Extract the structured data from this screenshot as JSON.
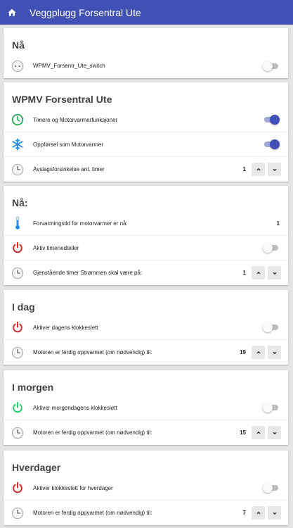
{
  "app": {
    "title": "Veggplugg Forsentral Ute"
  },
  "colors": {
    "primary": "#3f51b5",
    "power_red": "#d32f2f",
    "power_green": "#2ecc71",
    "timer_green": "#27ae60",
    "snow_blue": "#1e88e5"
  },
  "cards": [
    {
      "title": "Nå",
      "rows": [
        {
          "icon": "outlet-icon",
          "label": "WPMV_Forsentr_Ute_switch",
          "control": "toggle",
          "on": false
        }
      ]
    },
    {
      "title": "WPMV Forsentral Ute",
      "rows": [
        {
          "icon": "timer-icon",
          "label": "Timere og Motorvarmerfunksjoner",
          "control": "toggle",
          "on": true
        },
        {
          "icon": "snowflake-icon",
          "label": "Oppførsel som Motorvarmer",
          "control": "toggle",
          "on": true
        },
        {
          "icon": "clock-icon",
          "label": "Avslagsforsinkelse ant. timer",
          "control": "stepper",
          "value": "1"
        }
      ]
    },
    {
      "title": "Nå:",
      "rows": [
        {
          "icon": "thermometer-icon",
          "label": "Forvarmingstid for motorvarmer er nå:",
          "control": "value",
          "value": "1"
        },
        {
          "icon": "power-icon-red",
          "label": "Aktiv timenedteller",
          "control": "toggle",
          "on": false
        },
        {
          "icon": "clock-icon",
          "label": "Gjenstående timer Strømmen skal være på:",
          "control": "stepper",
          "value": "1"
        }
      ]
    },
    {
      "title": "I dag",
      "rows": [
        {
          "icon": "power-icon-red",
          "label": "Aktiver dagens klokkeslett",
          "control": "toggle",
          "on": false
        },
        {
          "icon": "clock-icon",
          "label": "Motoren er ferdig oppvarmet (om nødvendig) til:",
          "control": "stepper",
          "value": "19"
        }
      ]
    },
    {
      "title": "I morgen",
      "rows": [
        {
          "icon": "power-icon-green",
          "label": "Aktiver morgendagens klokkeslett",
          "control": "toggle",
          "on": false
        },
        {
          "icon": "clock-icon",
          "label": "Motoren er ferdig oppvarmet (om nødvendig) til:",
          "control": "stepper",
          "value": "15"
        }
      ]
    },
    {
      "title": "Hverdager",
      "rows": [
        {
          "icon": "power-icon-red",
          "label": "Aktiver klokkeslett for hverdager",
          "control": "toggle",
          "on": false
        },
        {
          "icon": "clock-icon",
          "label": "Motoren er ferdig oppvarmet (om nødvendig) til:",
          "control": "stepper",
          "value": "7"
        }
      ]
    }
  ]
}
